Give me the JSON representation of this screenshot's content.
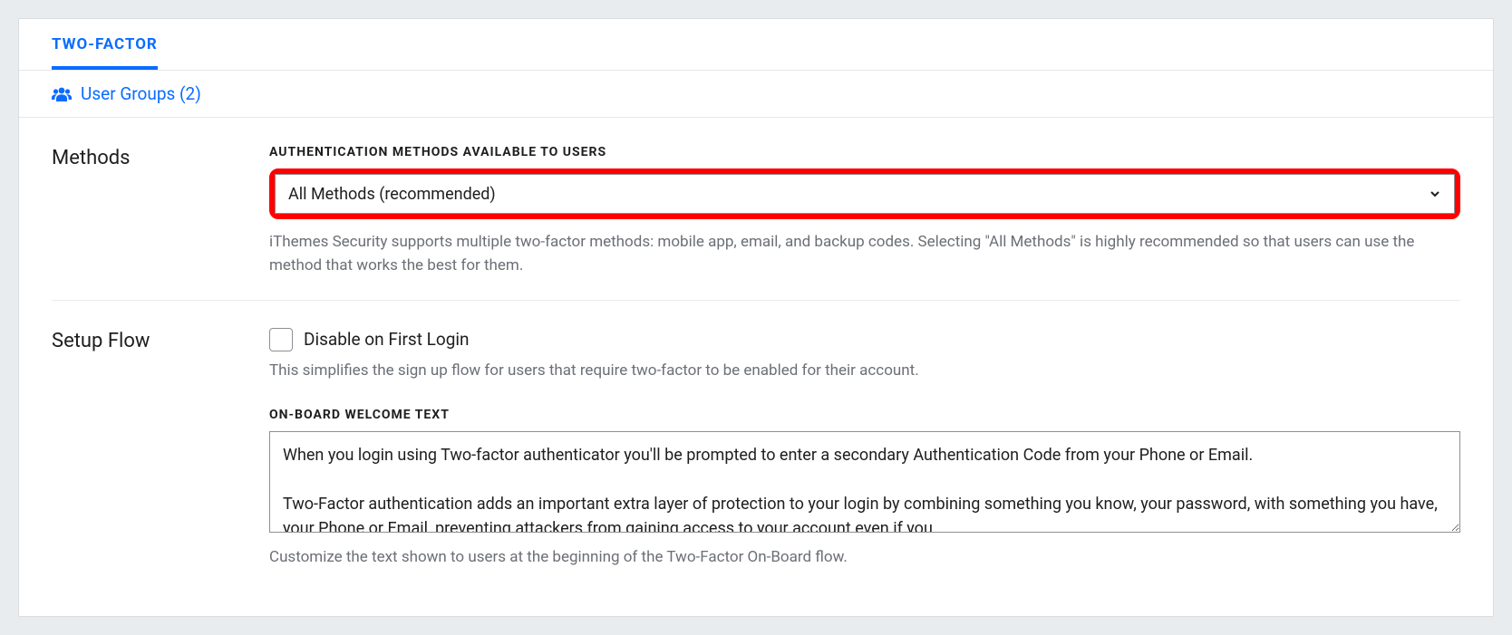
{
  "tab": {
    "label": "TWO-FACTOR"
  },
  "subheader": {
    "label": "User Groups (2)"
  },
  "methods": {
    "section_title": "Methods",
    "field_label": "AUTHENTICATION METHODS AVAILABLE TO USERS",
    "selected": "All Methods (recommended)",
    "help": "iThemes Security supports multiple two-factor methods: mobile app, email, and backup codes. Selecting \"All Methods\" is highly recommended so that users can use the method that works the best for them."
  },
  "setup_flow": {
    "section_title": "Setup Flow",
    "disable_label": "Disable on First Login",
    "disable_help": "This simplifies the sign up flow for users that require two-factor to be enabled for their account.",
    "welcome_label": "ON-BOARD WELCOME TEXT",
    "welcome_text": "When you login using Two-factor authenticator you'll be prompted to enter a secondary Authentication Code from your Phone or Email.\n\nTwo-Factor authentication adds an important extra layer of protection to your login by combining something you know, your password, with something you have, your Phone or Email, preventing attackers from gaining access to your account even if you",
    "welcome_help": "Customize the text shown to users at the beginning of the Two-Factor On-Board flow."
  }
}
